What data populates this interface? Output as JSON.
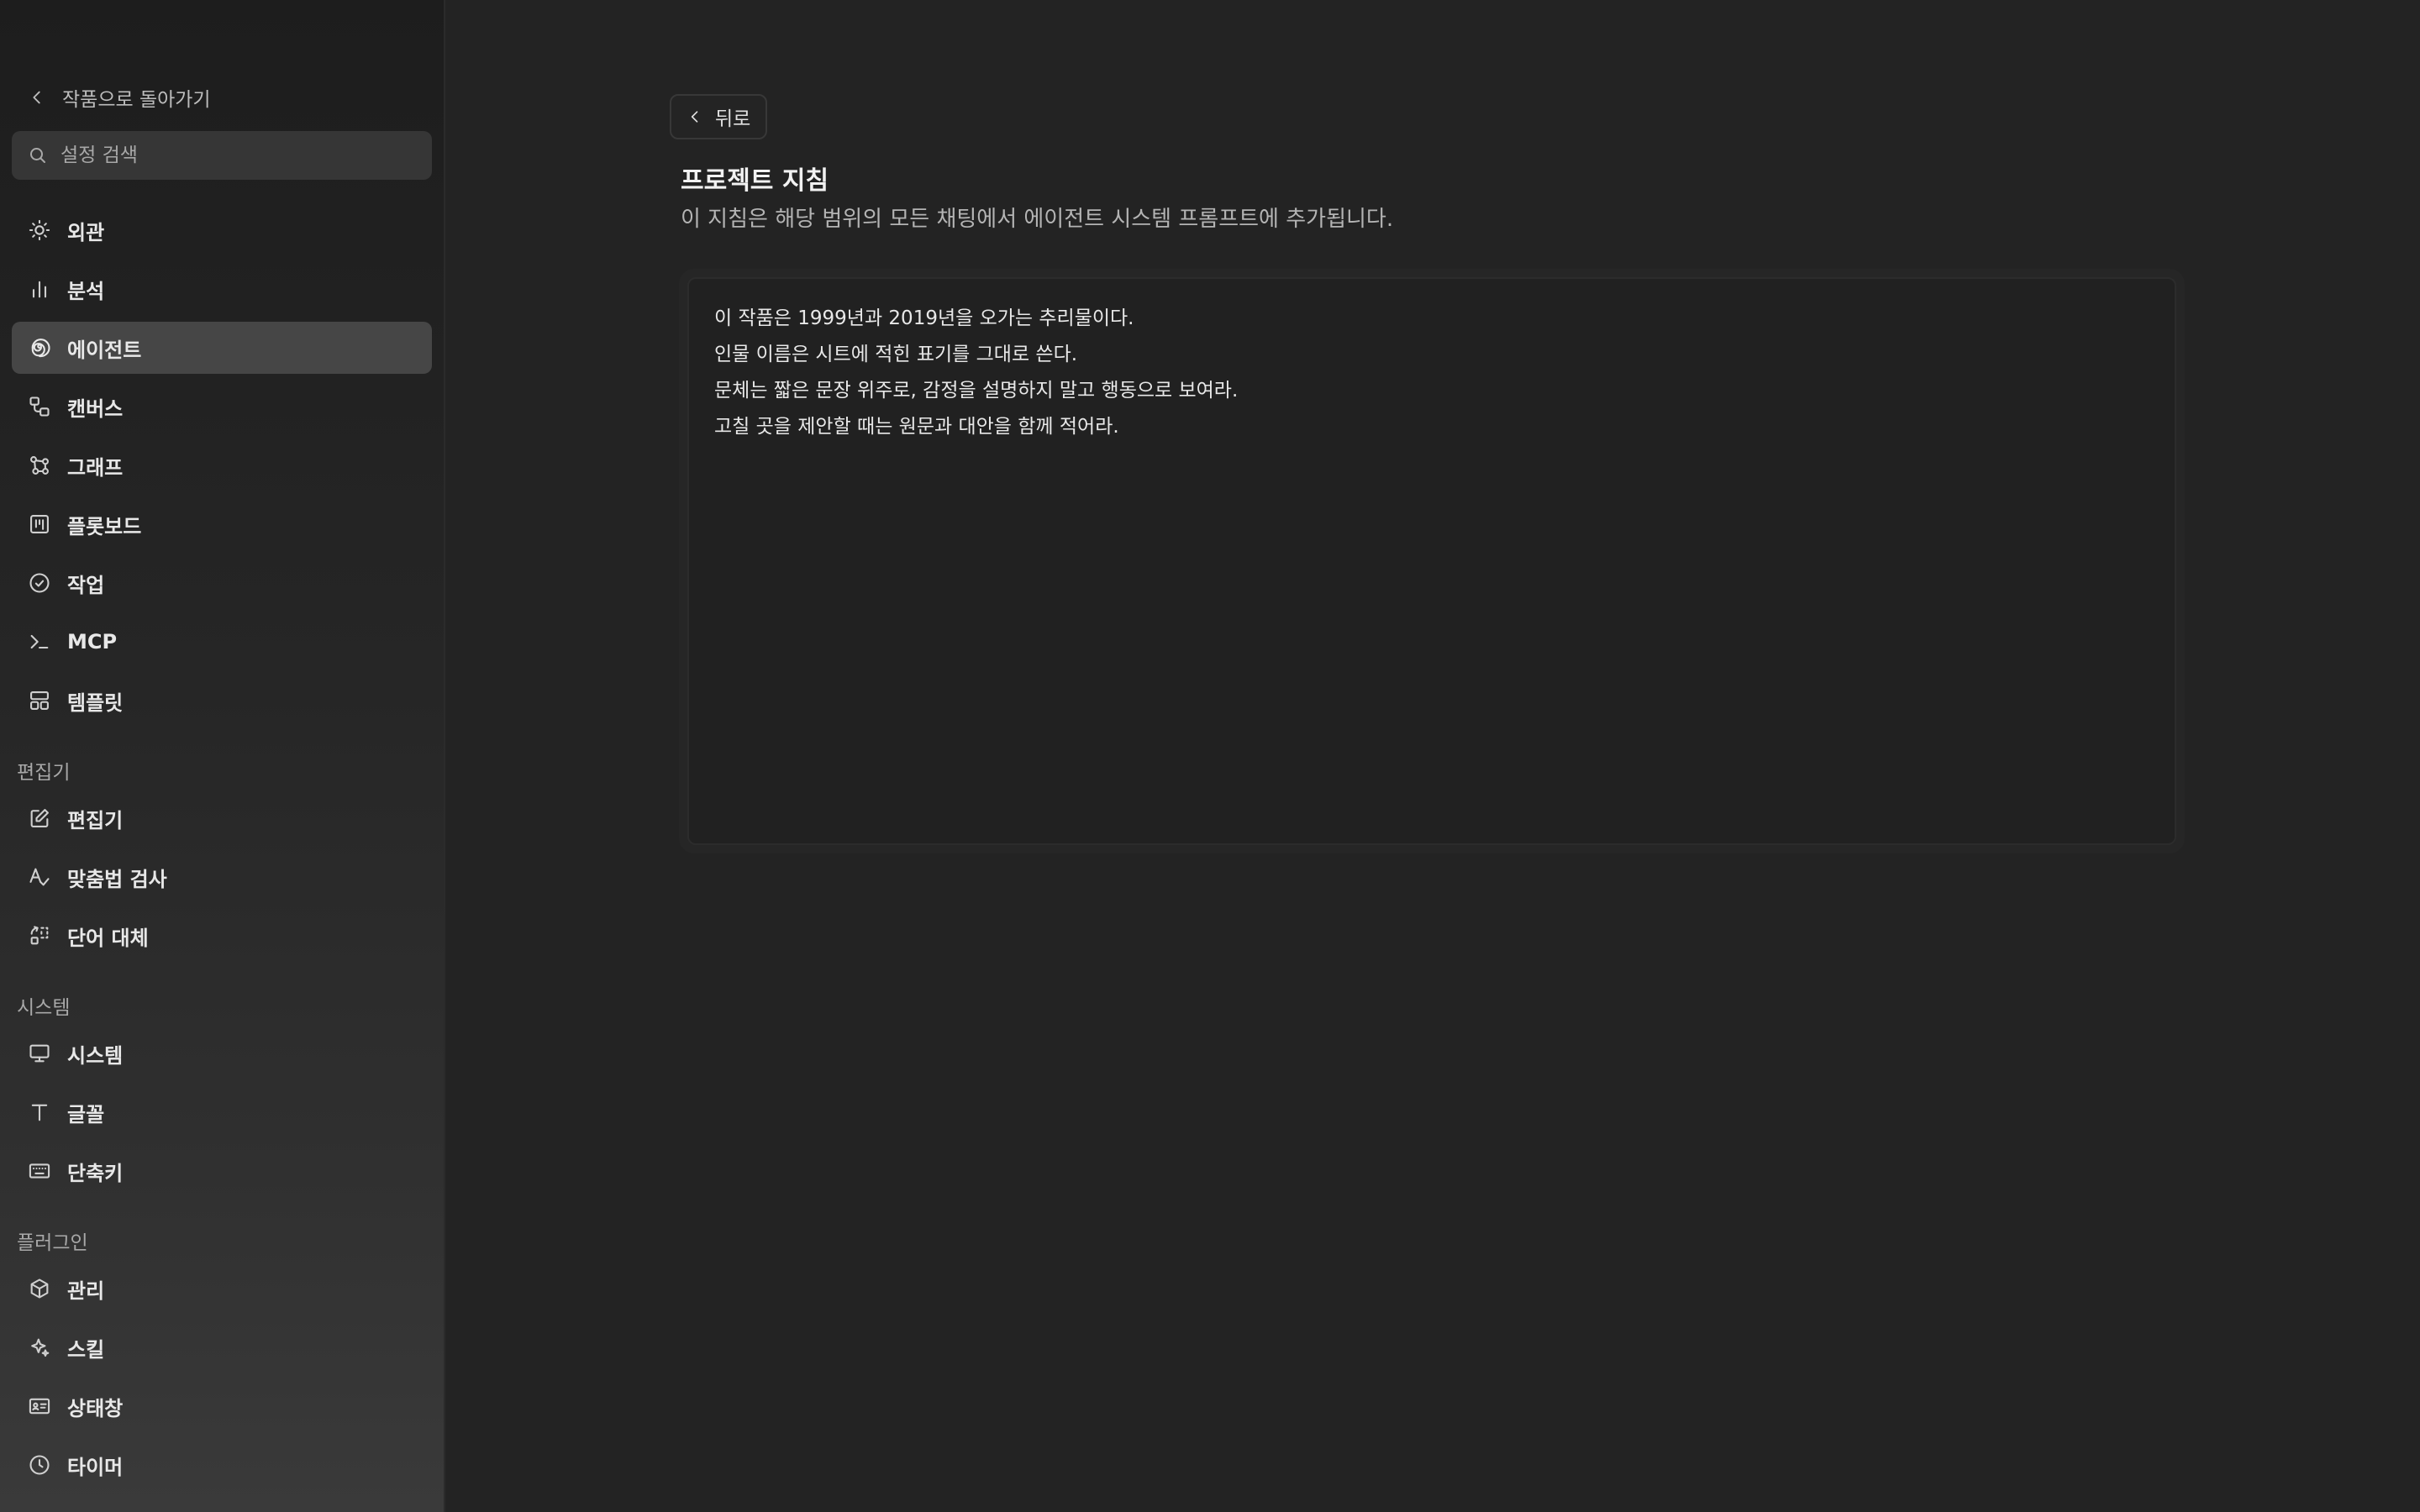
{
  "sidebar": {
    "back_label": "작품으로 돌아가기",
    "search_placeholder": "설정 검색",
    "items": [
      {
        "label": "외관",
        "icon": "sun-icon"
      },
      {
        "label": "분석",
        "icon": "bar-chart-icon"
      },
      {
        "label": "에이전트",
        "icon": "spiral-icon",
        "active": true
      },
      {
        "label": "캔버스",
        "icon": "canvas-icon"
      },
      {
        "label": "그래프",
        "icon": "graph-icon"
      },
      {
        "label": "플롯보드",
        "icon": "kanban-icon"
      },
      {
        "label": "작업",
        "icon": "check-circle-icon"
      },
      {
        "label": "MCP",
        "icon": "terminal-icon"
      },
      {
        "label": "템플릿",
        "icon": "layout-icon"
      }
    ],
    "sections": [
      {
        "label": "편집기",
        "items": [
          {
            "label": "편집기",
            "icon": "edit-icon"
          },
          {
            "label": "맞춤법 검사",
            "icon": "spell-check-icon"
          },
          {
            "label": "단어 대체",
            "icon": "replace-icon"
          }
        ]
      },
      {
        "label": "시스템",
        "items": [
          {
            "label": "시스템",
            "icon": "monitor-icon"
          },
          {
            "label": "글꼴",
            "icon": "type-icon"
          },
          {
            "label": "단축키",
            "icon": "keyboard-icon"
          }
        ]
      },
      {
        "label": "플러그인",
        "items": [
          {
            "label": "관리",
            "icon": "package-icon"
          },
          {
            "label": "스킬",
            "icon": "sparkle-icon"
          },
          {
            "label": "상태창",
            "icon": "id-card-icon"
          },
          {
            "label": "타이머",
            "icon": "clock-icon"
          }
        ]
      }
    ]
  },
  "main": {
    "back_button_label": "뒤로",
    "title": "프로젝트 지침",
    "description": "이 지침은 해당 범위의 모든 채팅에서 에이전트 시스템 프롬프트에 추가됩니다.",
    "instructions": [
      "이 작품은 1999년과 2019년을 오가는 추리물이다.",
      "인물 이름은 시트에 적힌 표기를 그대로 쓴다.",
      "문체는 짧은 문장 위주로, 감정을 설명하지 말고 행동으로 보여라.",
      "고칠 곳을 제안할 때는 원문과 대안을 함께 적어라."
    ]
  }
}
